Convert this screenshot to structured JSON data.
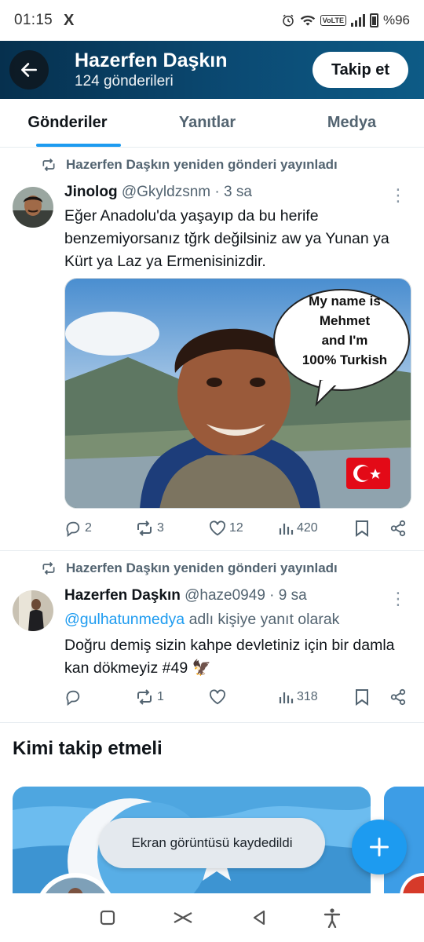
{
  "status_bar": {
    "time": "01:15",
    "notification_app": "X",
    "volte": "VoLTE",
    "battery": "%96"
  },
  "header": {
    "title": "Hazerfen Daşkın",
    "subtitle": "124 gönderileri",
    "follow_label": "Takip et"
  },
  "tabs": [
    {
      "label": "Gönderiler",
      "active": true
    },
    {
      "label": "Yanıtlar",
      "active": false
    },
    {
      "label": "Medya",
      "active": false
    }
  ],
  "tweets": [
    {
      "repost_label": "Hazerfen Daşkın yeniden gönderi yayınladı",
      "display_name": "Jinolog",
      "handle": "@Gkyldzsnm",
      "time": "· 3 sa",
      "text": "Eğer Anadolu'da yaşayıp da  bu herife benzemiyorsanız tğrk değilsiniz aw ya Yunan ya Kürt ya Laz ya Ermenisinizdir.",
      "media": {
        "bubble_lines": [
          "My name is",
          "Mehmet",
          "and I'm",
          "100% Turkish"
        ],
        "flag": "🇹🇷"
      },
      "replies": "2",
      "reposts": "3",
      "likes": "12",
      "views": "420"
    },
    {
      "repost_label": "Hazerfen Daşkın yeniden gönderi yayınladı",
      "display_name": "Hazerfen Daşkın",
      "handle": "@haze0949",
      "time": "· 9 sa",
      "reply_to_user": "@gulhatunmedya",
      "reply_to_suffix": " adlı kişiye yanıt olarak",
      "text": "Doğru demiş sizin kahpe devletiniz için bir damla kan dökmeyiz #49 🦅",
      "replies": "",
      "reposts": "1",
      "likes": "",
      "views": "318"
    }
  ],
  "who_to_follow": {
    "title": "Kimi takip etmeli"
  },
  "toast": "Ekran görüntüsü kaydedildi",
  "colors": {
    "accent": "#1d9bf0",
    "header_bg": "#0b4a73",
    "secondary_text": "#536471"
  }
}
